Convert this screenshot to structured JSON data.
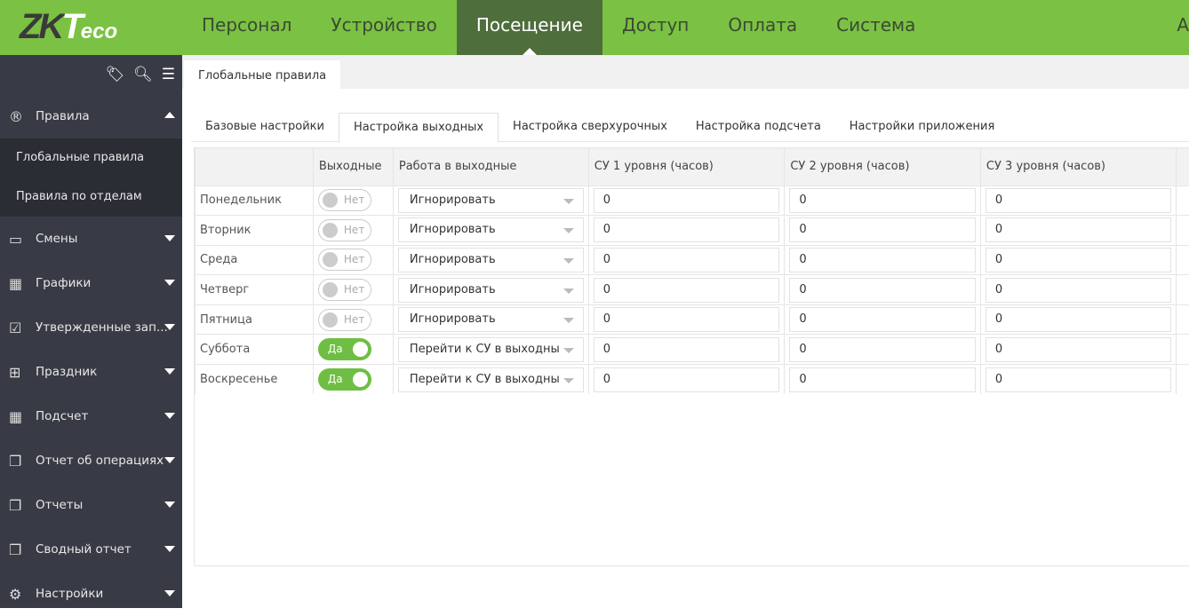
{
  "header": {
    "logo": "ZKTeco",
    "nav": [
      "Персонал",
      "Устройство",
      "Посещение",
      "Доступ",
      "Оплата",
      "Система"
    ],
    "active_nav": 2,
    "user_truncated": "A"
  },
  "sidebar": {
    "tools": [
      "tags-icon",
      "search-icon",
      "list-icon"
    ],
    "rules": {
      "label": "Правила",
      "children": [
        "Глобальные правила",
        "Правила по отделам"
      ]
    },
    "items": [
      {
        "label": "Смены",
        "icon": "calendar-icon"
      },
      {
        "label": "Графики",
        "icon": "calendar-grid-icon"
      },
      {
        "label": "Утвержденные зап...",
        "icon": "checkbox-icon"
      },
      {
        "label": "Праздник",
        "icon": "calendar-plus-icon"
      },
      {
        "label": "Подсчет",
        "icon": "calculator-icon"
      },
      {
        "label": "Отчет об операциях",
        "icon": "copy-icon"
      },
      {
        "label": "Отчеты",
        "icon": "copy-icon"
      },
      {
        "label": "Сводный отчет",
        "icon": "copy-icon"
      },
      {
        "label": "Настройки",
        "icon": "gears-icon"
      }
    ]
  },
  "main": {
    "page_tab": "Глобальные правила",
    "subtabs": [
      "Базовые настройки",
      "Настройка выходных",
      "Настройка сверхурочных",
      "Настройка подсчета",
      "Настройки приложения"
    ],
    "active_subtab": 1,
    "columns": [
      "",
      "Выходные",
      "Работа в выходные",
      "СУ 1 уровня (часов)",
      "СУ 2 уровня (часов)",
      "СУ 3 уровня (часов)"
    ],
    "rows": [
      {
        "day": "Понедельник",
        "weekend": false,
        "switch": "Нет",
        "work": "Игнорировать",
        "ot1": "0",
        "ot2": "0",
        "ot3": "0"
      },
      {
        "day": "Вторник",
        "weekend": false,
        "switch": "Нет",
        "work": "Игнорировать",
        "ot1": "0",
        "ot2": "0",
        "ot3": "0"
      },
      {
        "day": "Среда",
        "weekend": false,
        "switch": "Нет",
        "work": "Игнорировать",
        "ot1": "0",
        "ot2": "0",
        "ot3": "0"
      },
      {
        "day": "Четверг",
        "weekend": false,
        "switch": "Нет",
        "work": "Игнорировать",
        "ot1": "0",
        "ot2": "0",
        "ot3": "0"
      },
      {
        "day": "Пятница",
        "weekend": false,
        "switch": "Нет",
        "work": "Игнорировать",
        "ot1": "0",
        "ot2": "0",
        "ot3": "0"
      },
      {
        "day": "Суббота",
        "weekend": true,
        "switch": "Да",
        "work": "Перейти к СУ в выходны",
        "ot1": "0",
        "ot2": "0",
        "ot3": "0"
      },
      {
        "day": "Воскресенье",
        "weekend": true,
        "switch": "Да",
        "work": "Перейти к СУ в выходны",
        "ot1": "0",
        "ot2": "0",
        "ot3": "0"
      }
    ]
  },
  "colors": {
    "brand_green": "#7bc143",
    "active_nav": "#4e6e3c",
    "sidebar": "#383b45",
    "switch_on": "#6fbe44"
  }
}
